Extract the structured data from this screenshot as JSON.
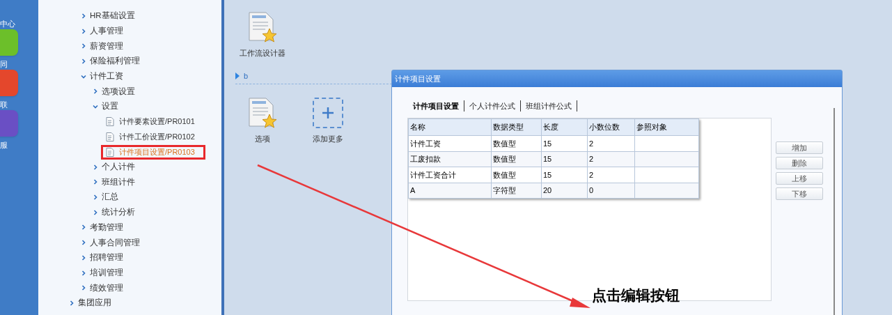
{
  "launcher": [
    {
      "label": "中心"
    },
    {
      "label": "同",
      "kind": "green"
    },
    {
      "label": "联",
      "kind": "red"
    },
    {
      "label": "服",
      "kind": "purple"
    }
  ],
  "tree": [
    {
      "label": "HR基础设置",
      "kind": "folder",
      "expanded": false
    },
    {
      "label": "人事管理",
      "kind": "folder",
      "expanded": false
    },
    {
      "label": "薪资管理",
      "kind": "folder",
      "expanded": false
    },
    {
      "label": "保险福利管理",
      "kind": "folder",
      "expanded": false
    },
    {
      "label": "计件工资",
      "kind": "folder",
      "expanded": true,
      "children": [
        {
          "label": "选项设置",
          "kind": "folder",
          "expanded": false
        },
        {
          "label": "设置",
          "kind": "folder",
          "expanded": true,
          "children": [
            {
              "label": "计件要素设置/PR0101",
              "kind": "doc",
              "selected": false
            },
            {
              "label": "计件工价设置/PR0102",
              "kind": "doc",
              "selected": false
            },
            {
              "label": "计件项目设置/PR0103",
              "kind": "doc",
              "selected": true
            }
          ]
        },
        {
          "label": "个人计件",
          "kind": "folder",
          "expanded": false
        },
        {
          "label": "班组计件",
          "kind": "folder",
          "expanded": false
        },
        {
          "label": "汇总",
          "kind": "folder",
          "expanded": false
        },
        {
          "label": "统计分析",
          "kind": "folder",
          "expanded": false
        }
      ]
    },
    {
      "label": "考勤管理",
      "kind": "folder",
      "expanded": false
    },
    {
      "label": "人事合同管理",
      "kind": "folder",
      "expanded": false
    },
    {
      "label": "招聘管理",
      "kind": "folder",
      "expanded": false
    },
    {
      "label": "培训管理",
      "kind": "folder",
      "expanded": false
    },
    {
      "label": "绩效管理",
      "kind": "folder",
      "expanded": false
    }
  ],
  "group_tree": [
    {
      "label": "集团应用",
      "kind": "folder",
      "expanded": false
    }
  ],
  "shortcuts_top": [
    {
      "label": "工作流设计器",
      "kind": "doc"
    }
  ],
  "section": {
    "label": "b",
    "shortcuts": [
      {
        "label": "选项",
        "kind": "doc"
      },
      {
        "label": "添加更多",
        "kind": "add"
      }
    ]
  },
  "dialog": {
    "title": "计件项目设置",
    "tabs": [
      {
        "label": "计件项目设置",
        "selected": true
      },
      {
        "label": "个人计件公式",
        "selected": false
      },
      {
        "label": "班组计件公式",
        "selected": false
      }
    ],
    "table": {
      "columns": [
        "名称",
        "数据类型",
        "长度",
        "小数位数",
        "参照对象"
      ],
      "rows": [
        [
          "计件工资",
          "数值型",
          "15",
          "2",
          ""
        ],
        [
          "工废扣款",
          "数值型",
          "15",
          "2",
          ""
        ],
        [
          "计件工资合计",
          "数值型",
          "15",
          "2",
          ""
        ],
        [
          "A",
          "字符型",
          "20",
          "0",
          ""
        ]
      ]
    },
    "buttons": [
      "增加",
      "删除",
      "上移",
      "下移"
    ]
  },
  "annotation": {
    "text": "点击编辑按钮"
  }
}
